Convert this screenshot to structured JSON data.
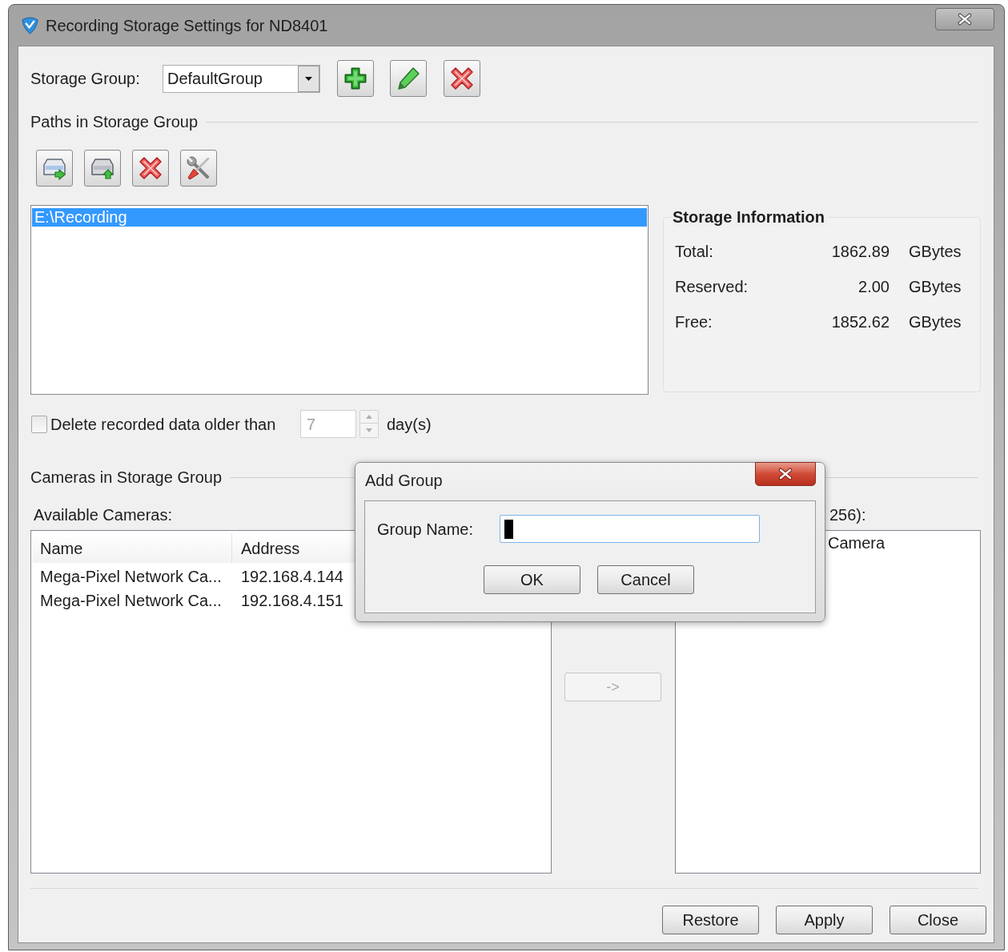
{
  "window": {
    "title": "Recording Storage Settings for ND8401"
  },
  "storage_group": {
    "label": "Storage Group:",
    "value": "DefaultGroup"
  },
  "paths": {
    "title": "Paths in Storage Group",
    "items": [
      {
        "path": "E:\\Recording",
        "selected": true
      }
    ]
  },
  "storage_info": {
    "title": "Storage Information",
    "rows": [
      {
        "label": "Total:",
        "value": "1862.89",
        "unit": "GBytes"
      },
      {
        "label": "Reserved:",
        "value": "2.00",
        "unit": "GBytes"
      },
      {
        "label": "Free:",
        "value": "1852.62",
        "unit": "GBytes"
      }
    ]
  },
  "auto_delete": {
    "label": "Delete recorded data older than",
    "checked": false,
    "value": "7",
    "disabled": true,
    "unit": "day(s)"
  },
  "cameras": {
    "title": "Cameras in Storage Group",
    "available": {
      "label": "Available Cameras:",
      "columns": [
        "Name",
        "Address"
      ],
      "rows": [
        {
          "cells": [
            "Mega-Pixel Network Ca...",
            "192.168.4.144"
          ],
          "selected": false
        },
        {
          "cells": [
            "Mega-Pixel Network Ca...",
            "192.168.4.151"
          ],
          "selected": false
        }
      ]
    },
    "move_button": {
      "label": "->",
      "disabled": true
    },
    "assigned": {
      "label": "256):",
      "header": "Camera"
    }
  },
  "buttons": [
    {
      "label": "Restore"
    },
    {
      "label": "Apply"
    },
    {
      "label": "Close"
    }
  ],
  "dialog": {
    "title": "Add Group",
    "field_label": "Group Name:",
    "focused": true,
    "buttons": [
      {
        "label": "OK"
      },
      {
        "label": "Cancel"
      }
    ]
  }
}
